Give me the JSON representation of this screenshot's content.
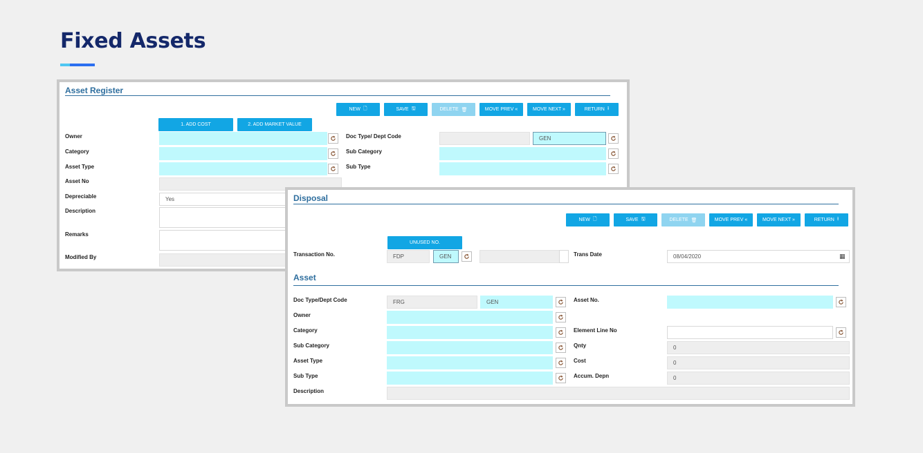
{
  "page": {
    "title": "Fixed Assets"
  },
  "asset_register": {
    "title": "Asset Register",
    "buttons": {
      "new": "NEW",
      "save": "SAVE",
      "delete": "DELETE",
      "move_prev": "MOVE PREV «",
      "move_next": "MOVE NEXT »",
      "return": "RETURN",
      "add_cost": "1. ADD COST",
      "add_market_value": "2. ADD MARKET VALUE"
    },
    "labels": {
      "owner": "Owner",
      "category": "Category",
      "asset_type": "Asset Type",
      "asset_no": "Asset No",
      "depreciable": "Depreciable",
      "description": "Description",
      "remarks": "Remarks",
      "modified_by": "Modified By",
      "doc_type": "Doc Type/ Dept Code",
      "sub_category": "Sub Category",
      "sub_type": "Sub Type"
    },
    "values": {
      "depreciable": "Yes",
      "dept_code": "GEN"
    }
  },
  "disposal": {
    "title": "Disposal",
    "buttons": {
      "new": "NEW",
      "save": "SAVE",
      "delete": "DELETE",
      "move_prev": "MOVE PREV «",
      "move_next": "MOVE NEXT »",
      "return": "RETURN",
      "unused_no": "UNUSED NO."
    },
    "labels": {
      "transaction_no": "Transaction No.",
      "trans_date": "Trans Date"
    },
    "values": {
      "transaction_prefix": "FDP",
      "transaction_dept": "GEN",
      "trans_date": "08/04/2020"
    }
  },
  "asset": {
    "title": "Asset",
    "labels": {
      "doc_type": "Doc Type/Dept Code",
      "owner": "Owner",
      "category": "Category",
      "sub_category": "Sub Category",
      "asset_type": "Asset Type",
      "sub_type": "Sub Type",
      "description": "Description",
      "asset_no": "Asset No.",
      "element_line_no": "Element Line No",
      "qnty": "Qnty",
      "cost": "Cost",
      "accum_depn": "Accum. Depn"
    },
    "values": {
      "doc_type": "FRG",
      "dept_code": "GEN",
      "qnty": "0",
      "cost": "0",
      "accum_depn": "0"
    }
  },
  "colors": {
    "accent": "#12a6e4",
    "field_cyan": "#bff9fd",
    "title": "#14286a",
    "section": "#2e6e9e"
  },
  "icons": {
    "lookup": "refresh-icon",
    "new": "file-icon",
    "save": "floppy-icon",
    "delete": "trash-icon",
    "return": "arrow-up-icon",
    "calendar": "calendar-icon"
  }
}
